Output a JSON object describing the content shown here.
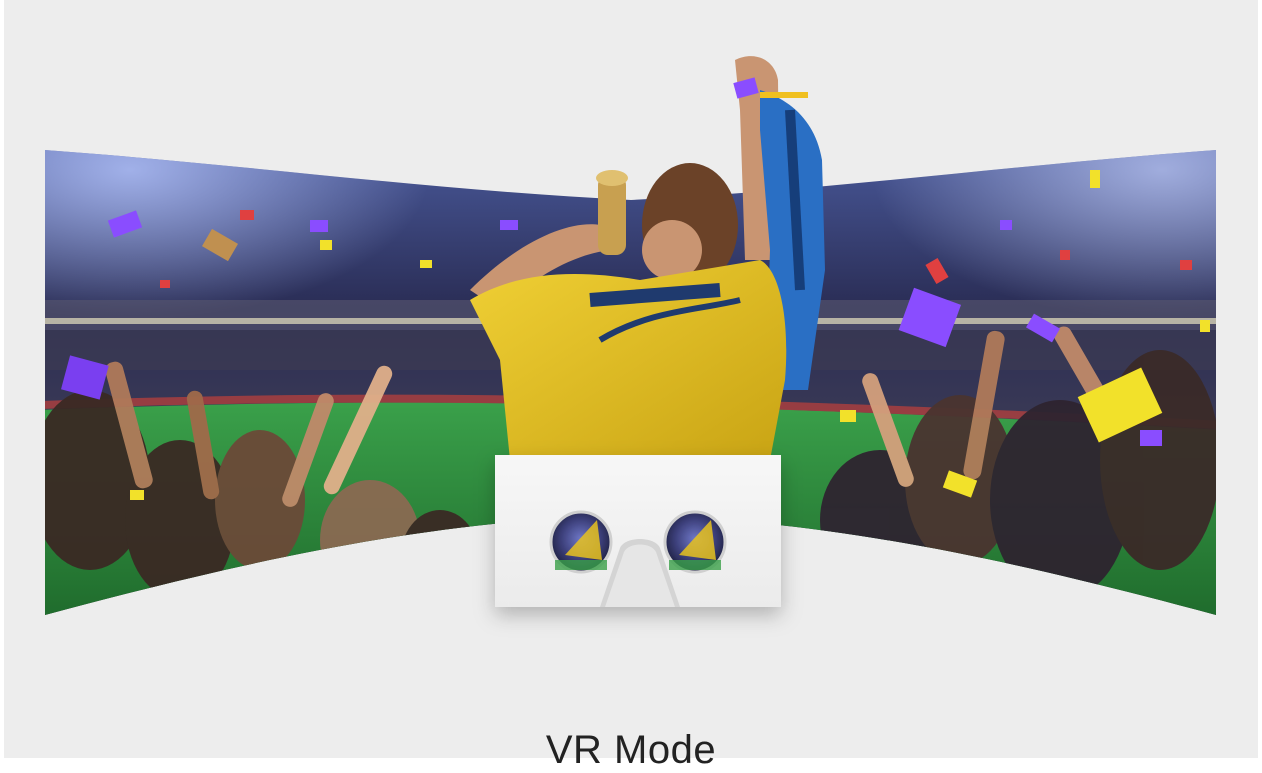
{
  "card": {
    "title": "VR Mode"
  },
  "illustration": {
    "panorama": "stadium-crowd-panorama",
    "headset": "vr-cardboard-headset-icon"
  },
  "colors": {
    "background": "#ededed",
    "jersey": "#e8c21e",
    "field": "#2f8a3a",
    "crowd_dark": "#23213a",
    "confetti_purple": "#8a4dff",
    "confetti_yellow": "#f2e12a",
    "scarf_blue": "#2a6fc4"
  }
}
